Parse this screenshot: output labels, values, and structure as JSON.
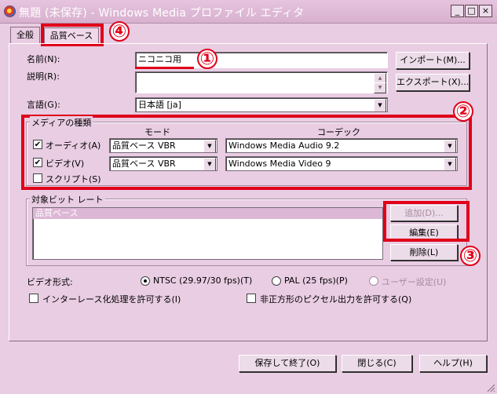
{
  "window": {
    "title": "無題 (未保存) - Windows Media プロファイル エディタ",
    "minimize": "_",
    "maximize": "□",
    "close": "×"
  },
  "tabs": [
    {
      "label": "全般"
    },
    {
      "label": "品質ベース"
    }
  ],
  "general": {
    "name_label": "名前(N):",
    "name_value": "ニコニコ用",
    "description_label": "説明(R):",
    "description_value": "",
    "language_label": "言語(G):",
    "language_value": "日本語 [ja]",
    "import_button": "インポート(M)...",
    "export_button": "エクスポート(X)..."
  },
  "media": {
    "group_title": "メディアの種類",
    "mode_header": "モード",
    "codec_header": "コーデック",
    "audio": {
      "label": "オーディオ(A)",
      "checked": true,
      "mode": "品質ベース VBR",
      "codec": "Windows Media Audio 9.2"
    },
    "video": {
      "label": "ビデオ(V)",
      "checked": true,
      "mode": "品質ベース VBR",
      "codec": "Windows Media Video 9"
    },
    "script": {
      "label": "スクリプト(S)",
      "checked": false
    }
  },
  "bitrate": {
    "group_title": "対象ビット レート",
    "items": [
      "品質ベース"
    ],
    "add_button": "追加(D)...",
    "edit_button": "編集(E)",
    "delete_button": "削除(L)"
  },
  "video_format": {
    "label": "ビデオ形式:",
    "ntsc": "NTSC (29.97/30 fps)(T)",
    "pal": "PAL (25 fps)(P)",
    "user": "ユーザー設定(U)",
    "selected": "ntsc"
  },
  "options": {
    "interlace": "インターレース化処理を許可する(I)",
    "nonsquare": "非正方形のピクセル出力を許可する(Q)"
  },
  "footer": {
    "save_button": "保存して終了(O)",
    "close_button": "閉じる(C)",
    "help_button": "ヘルプ(H)"
  },
  "annotations": [
    "①",
    "②",
    "③",
    "④"
  ],
  "colors": {
    "background": "#e9cde3",
    "highlight": "#e0001a",
    "selection": "#ddb7d6"
  }
}
